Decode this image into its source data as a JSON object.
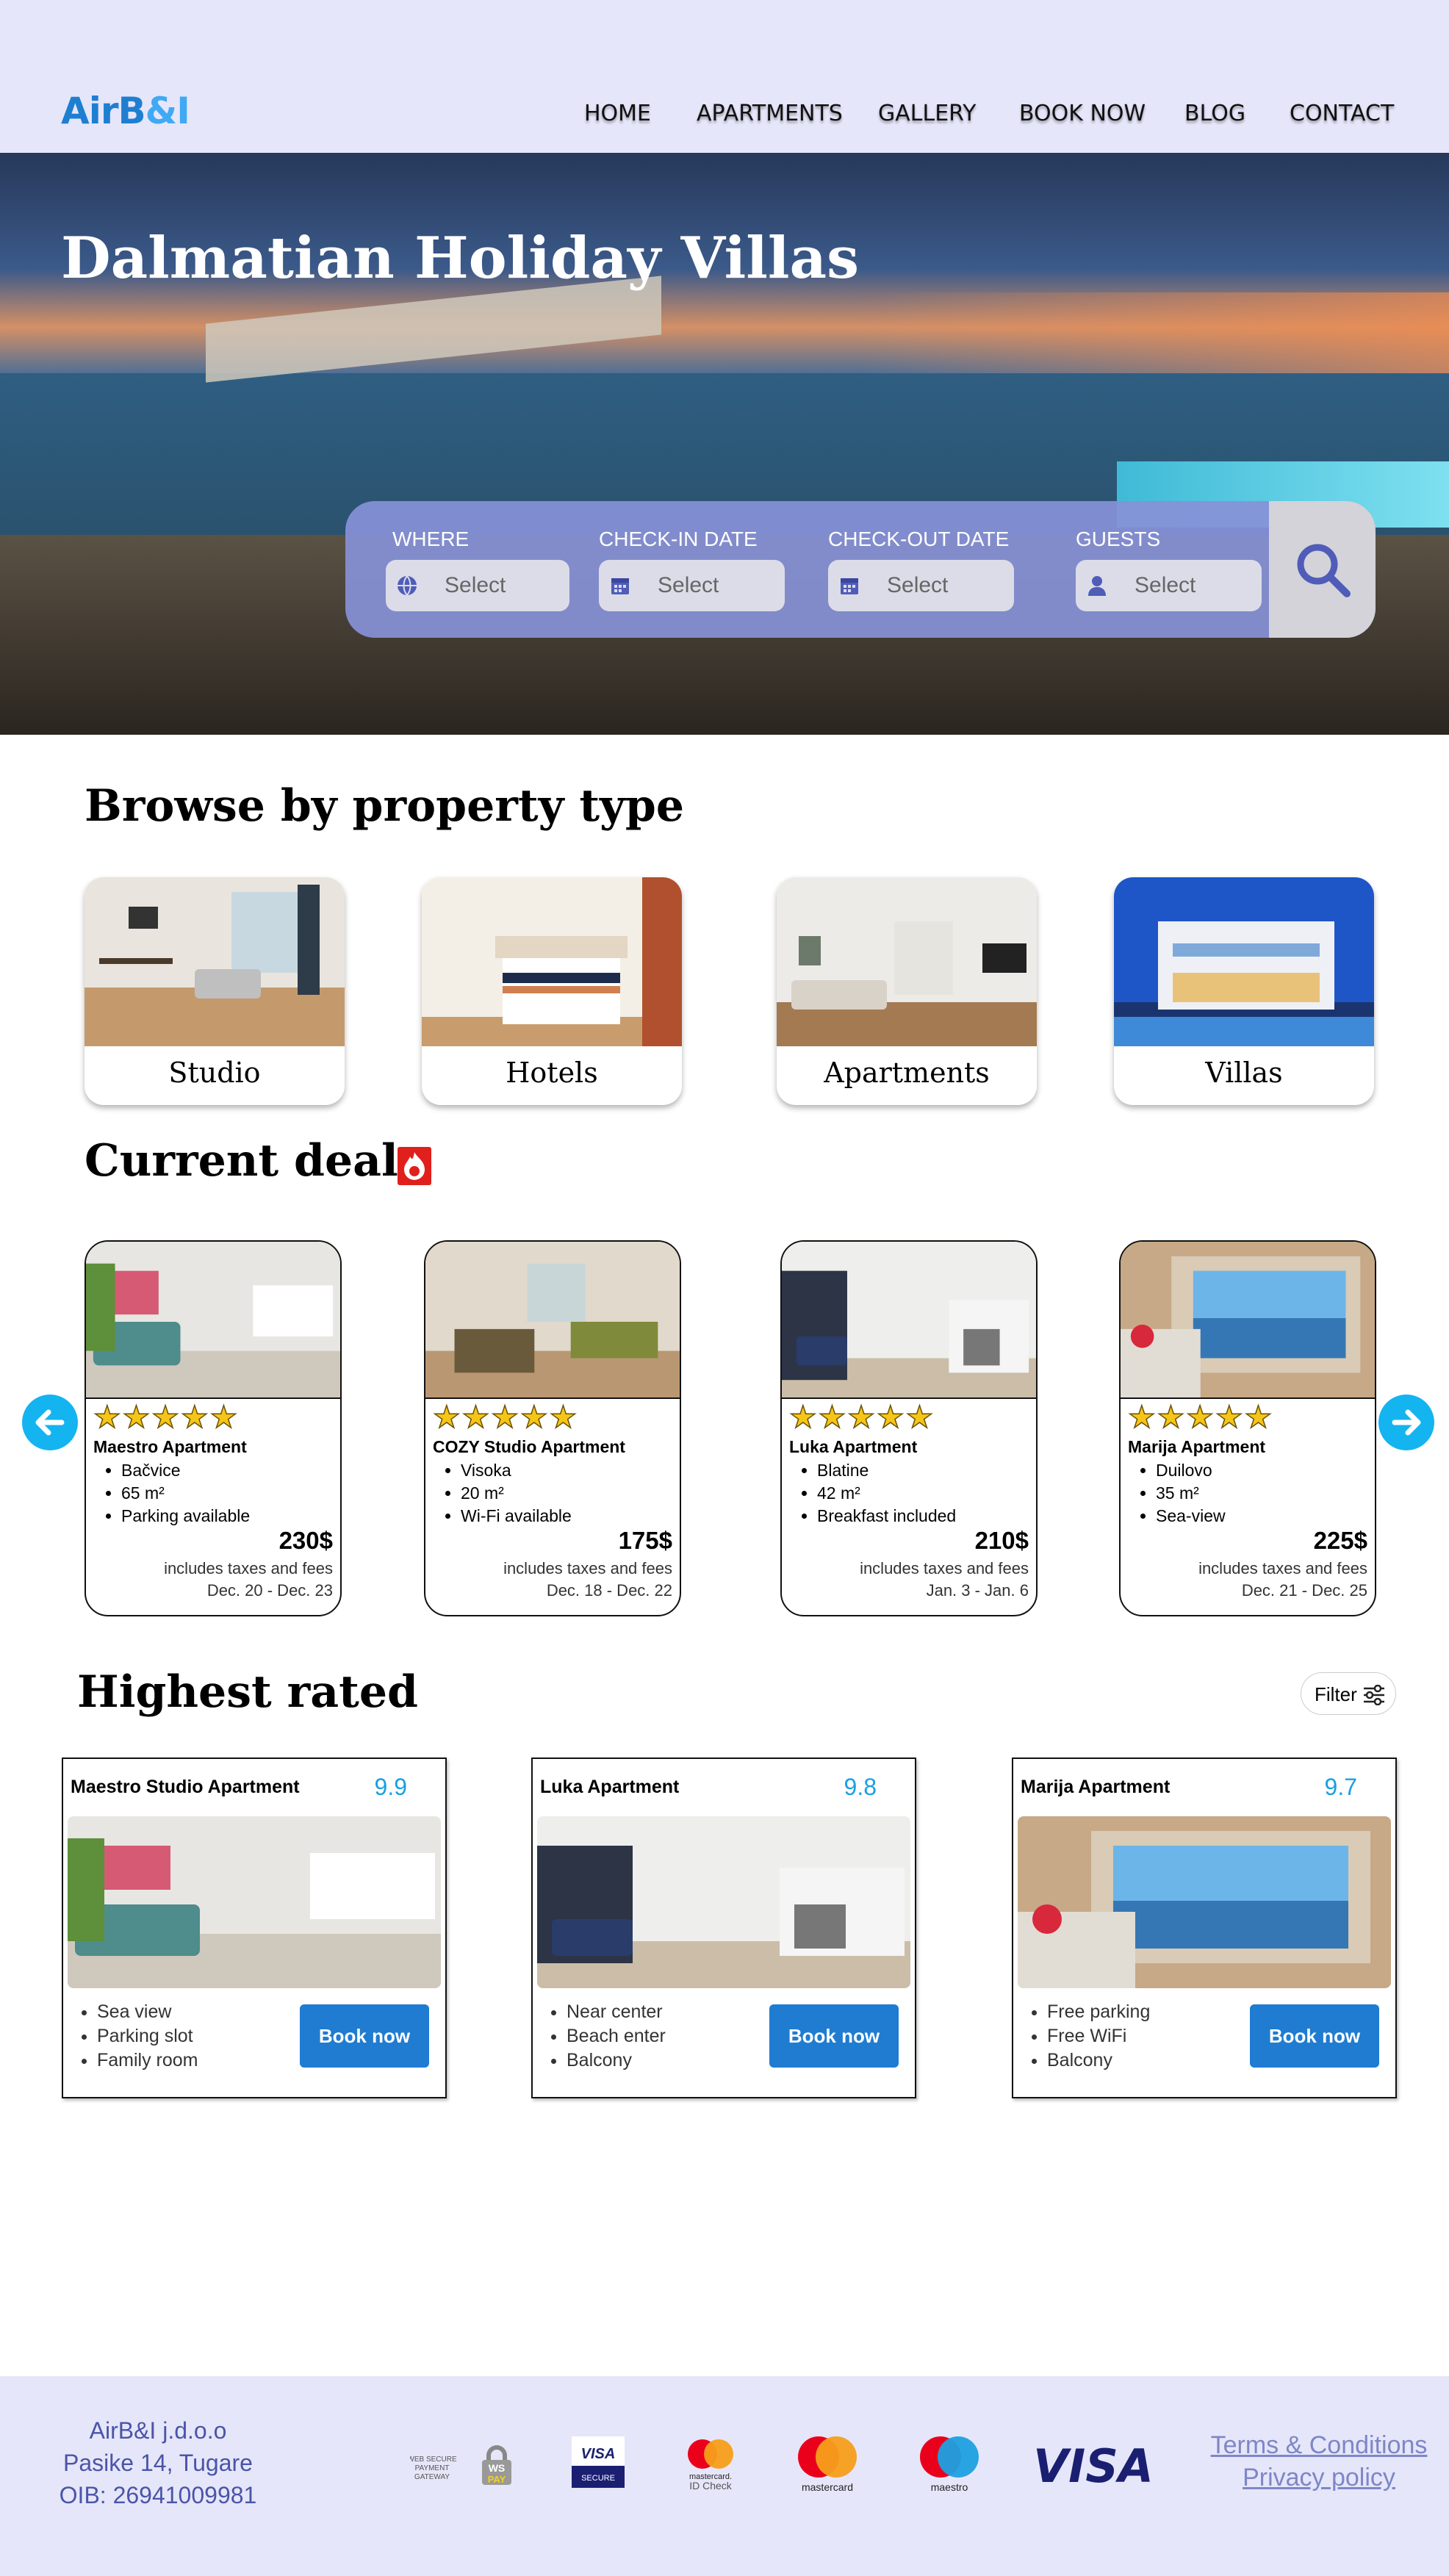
{
  "header": {
    "logo_part1": "AirB",
    "logo_part2": "&I",
    "nav": [
      "HOME",
      "APARTMENTS",
      "GALLERY",
      "BOOK NOW",
      "BLOG",
      "CONTACT"
    ]
  },
  "hero": {
    "title": "Dalmatian Holiday Villas",
    "search": {
      "where_label": "WHERE",
      "where_value": "Select",
      "checkin_label": "CHECK-IN DATE",
      "checkin_value": "Select",
      "checkout_label": "CHECK-OUT DATE",
      "checkout_value": "Select",
      "guests_label": "GUESTS",
      "guests_value": "Select",
      "search_icon": "search-icon"
    }
  },
  "browse": {
    "title": "Browse by property type",
    "types": [
      "Studio",
      "Hotels",
      "Apartments",
      "Villas"
    ]
  },
  "deals": {
    "title": "Current deals",
    "icon": "fire-icon",
    "rating_stars": 5,
    "cards": [
      {
        "name": "Maestro Apartment",
        "features": [
          "Bačvice",
          "65 m²",
          "Parking available"
        ],
        "price": "230$",
        "fees": "includes taxes and fees",
        "dates": "Dec. 20 - Dec. 23"
      },
      {
        "name": "COZY Studio Apartment",
        "features": [
          "Visoka",
          "20 m²",
          "Wi-Fi available"
        ],
        "price": "175$",
        "fees": "includes taxes and fees",
        "dates": "Dec. 18 - Dec. 22"
      },
      {
        "name": "Luka Apartment",
        "features": [
          "Blatine",
          "42 m²",
          "Breakfast included"
        ],
        "price": "210$",
        "fees": "includes taxes and fees",
        "dates": "Jan. 3 - Jan. 6"
      },
      {
        "name": "Marija Apartment",
        "features": [
          "Duilovo",
          "35 m²",
          "Sea-view"
        ],
        "price": "225$",
        "fees": "includes taxes and fees",
        "dates": "Dec. 21 - Dec. 25"
      }
    ]
  },
  "rated": {
    "title": "Highest rated",
    "filter_label": "Filter",
    "cards": [
      {
        "name": "Maestro Studio Apartment",
        "score": "9.9",
        "features": [
          "Sea view",
          "Parking slot",
          "Family room"
        ],
        "button": "Book now"
      },
      {
        "name": "Luka Apartment",
        "score": "9.8",
        "features": [
          "Near center",
          "Beach enter",
          "Balcony"
        ],
        "button": "Book now"
      },
      {
        "name": "Marija Apartment",
        "score": "9.7",
        "features": [
          "Free parking",
          "Free WiFi",
          "Balcony"
        ],
        "button": "Book now"
      }
    ]
  },
  "footer": {
    "company_name": "AirB&I j.d.o.o",
    "address": "Pasike 14, Tugare",
    "oib": "OIB: 26941009981",
    "payments": {
      "wspay_line1": "WEB SECURE",
      "wspay_line2": "PAYMENT",
      "wspay_line3": "GATEWAY",
      "wspay_logo_top": "WS",
      "wspay_logo_bottom": "PAY",
      "visa_secure_top": "VISA",
      "visa_secure_bottom": "SECURE",
      "mc_idcheck_line1": "mastercard.",
      "mc_idcheck_line2": "ID Check",
      "mastercard": "mastercard",
      "maestro": "maestro",
      "visa": "VISA"
    },
    "terms": "Terms & Conditions",
    "privacy": "Privacy policy"
  }
}
